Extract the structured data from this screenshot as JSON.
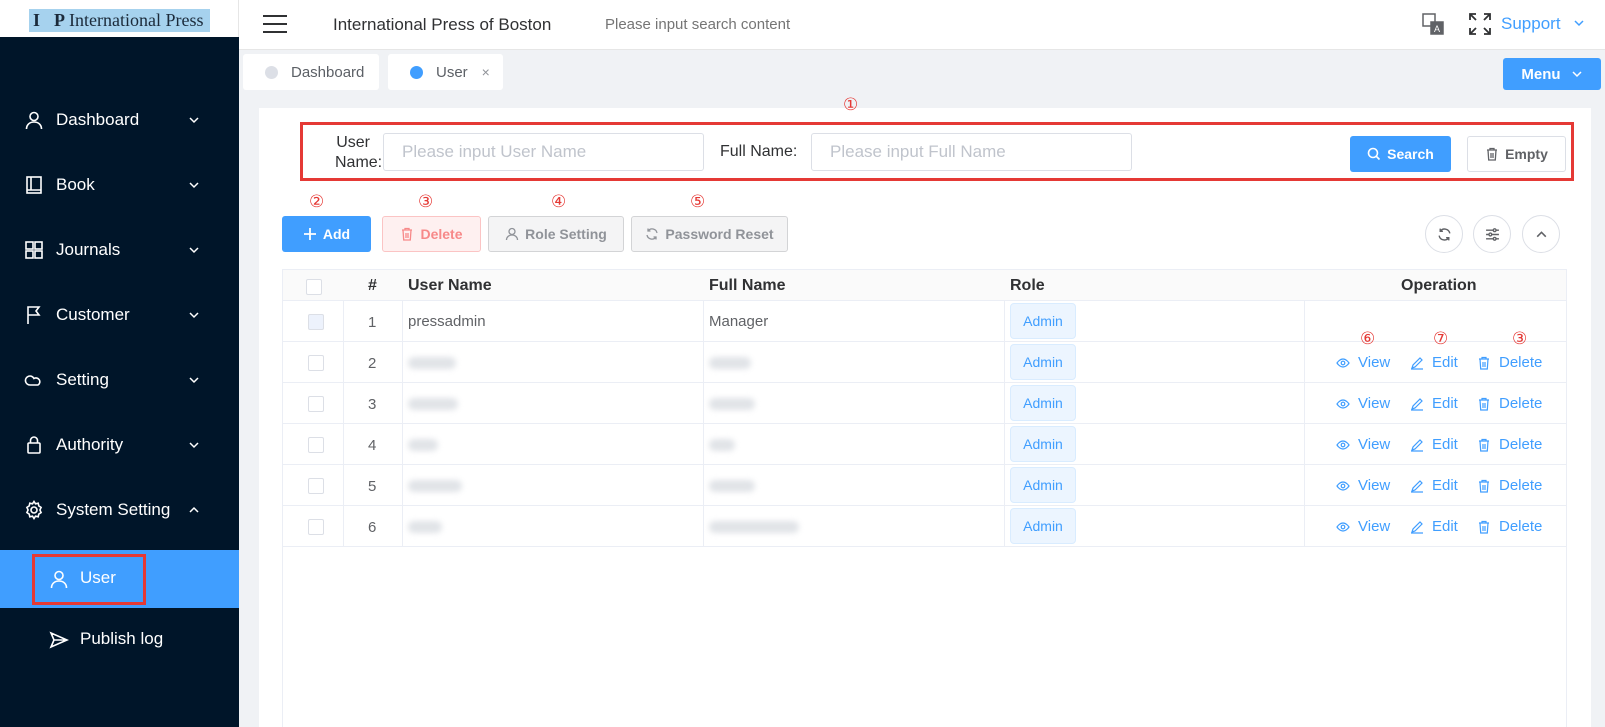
{
  "app": {
    "logo_text": "International Press"
  },
  "sidebar": {
    "items": [
      {
        "label": "Dashboard",
        "icon": "user-icon"
      },
      {
        "label": "Book",
        "icon": "book-icon"
      },
      {
        "label": "Journals",
        "icon": "grid-icon"
      },
      {
        "label": "Customer",
        "icon": "flag-icon"
      },
      {
        "label": "Setting",
        "icon": "cloud-icon"
      },
      {
        "label": "Authority",
        "icon": "lock-icon"
      },
      {
        "label": "System Setting",
        "icon": "gear-icon",
        "expanded": true
      }
    ],
    "sub_items": [
      {
        "label": "User",
        "icon": "user-icon",
        "active": true
      },
      {
        "label": "Publish log",
        "icon": "send-icon",
        "active": false
      }
    ]
  },
  "header": {
    "title": "International Press of Boston",
    "search_placeholder": "Please input search content",
    "support_label": "Support"
  },
  "tabs": [
    {
      "label": "Dashboard",
      "active": false
    },
    {
      "label": "User",
      "active": true,
      "close": "×"
    }
  ],
  "menu_button": "Menu",
  "annotations": {
    "a1": "①",
    "a2": "②",
    "a3": "③",
    "a4": "④",
    "a5": "⑤",
    "a6": "⑥",
    "a7": "⑦"
  },
  "search": {
    "username_label": "User Name:",
    "username_placeholder": "Please input User Name",
    "fullname_label": "Full Name:",
    "fullname_placeholder": "Please input Full Name",
    "search_button": "Search",
    "empty_button": "Empty"
  },
  "toolbar": {
    "add": "Add",
    "delete": "Delete",
    "role_setting": "Role Setting",
    "password_reset": "Password Reset"
  },
  "table": {
    "columns": [
      "#",
      "User Name",
      "Full Name",
      "Role",
      "Operation"
    ],
    "rows": [
      {
        "index": "1",
        "username": "pressadmin",
        "fullname": "Manager",
        "role": "Admin"
      },
      {
        "index": "2",
        "username": "",
        "fullname": "",
        "role": "Admin"
      },
      {
        "index": "3",
        "username": "",
        "fullname": "",
        "role": "Admin"
      },
      {
        "index": "4",
        "username": "",
        "fullname": "",
        "role": "Admin"
      },
      {
        "index": "5",
        "username": "",
        "fullname": "",
        "role": "Admin"
      },
      {
        "index": "6",
        "username": "",
        "fullname": "",
        "role": "Admin"
      }
    ],
    "ops": {
      "view": "View",
      "edit": "Edit",
      "delete": "Delete"
    }
  },
  "colors": {
    "sidebar_bg": "#001529",
    "accent": "#409eff",
    "annotation_red": "#e53935"
  }
}
